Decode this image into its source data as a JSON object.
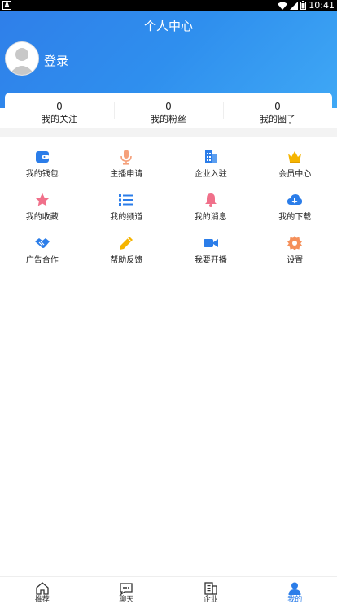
{
  "status_bar": {
    "time": "10:41",
    "left_icon": "A"
  },
  "header": {
    "title": "个人中心",
    "login_label": "登录"
  },
  "stats": [
    {
      "value": "0",
      "label": "我的关注"
    },
    {
      "value": "0",
      "label": "我的粉丝"
    },
    {
      "value": "0",
      "label": "我的圈子"
    }
  ],
  "menu": [
    {
      "label": "我的钱包",
      "icon": "wallet-icon",
      "color": "#2b7de9"
    },
    {
      "label": "主播申请",
      "icon": "microphone-icon",
      "color": "#f5a07a"
    },
    {
      "label": "企业入驻",
      "icon": "building-icon",
      "color": "#2b7de9"
    },
    {
      "label": "会员中心",
      "icon": "crown-icon",
      "color": "#f5b400"
    },
    {
      "label": "我的收藏",
      "icon": "star-icon",
      "color": "#f0708a"
    },
    {
      "label": "我的频道",
      "icon": "list-icon",
      "color": "#2b7de9"
    },
    {
      "label": "我的消息",
      "icon": "bell-icon",
      "color": "#f0708a"
    },
    {
      "label": "我的下载",
      "icon": "cloud-download-icon",
      "color": "#2b7de9"
    },
    {
      "label": "广告合作",
      "icon": "handshake-icon",
      "color": "#2b7de9"
    },
    {
      "label": "帮助反馈",
      "icon": "pencil-icon",
      "color": "#f5b400"
    },
    {
      "label": "我要开播",
      "icon": "video-camera-icon",
      "color": "#2b7de9"
    },
    {
      "label": "设置",
      "icon": "gear-icon",
      "color": "#f5905a"
    }
  ],
  "tabs": [
    {
      "label": "推荐",
      "icon": "home-icon",
      "active": false
    },
    {
      "label": "聊天",
      "icon": "chat-icon",
      "active": false
    },
    {
      "label": "企业",
      "icon": "company-icon",
      "active": false
    },
    {
      "label": "我的",
      "icon": "user-icon",
      "active": true
    }
  ],
  "colors": {
    "accent": "#2b7de9"
  }
}
